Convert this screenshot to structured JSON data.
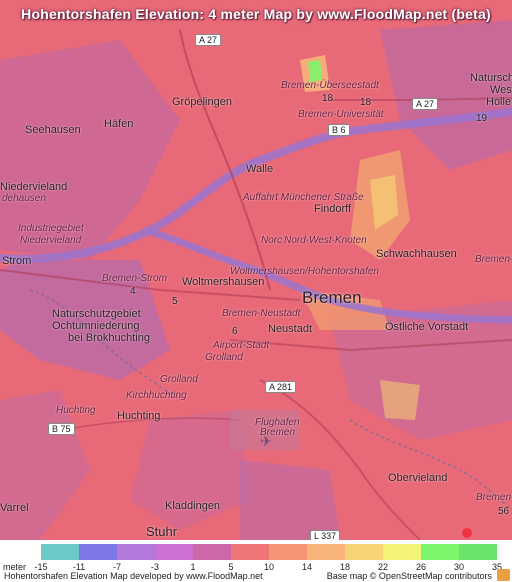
{
  "title": "Hohentorshafen Elevation: 4 meter Map by www.FloodMap.net (beta)",
  "labels": {
    "seehausen": "Seehausen",
    "haefen": "Häfen",
    "groepelingen": "Gröpelingen",
    "walle": "Walle",
    "niedervieland": "Niedervieland",
    "niedervieland_small": "Niedervieland",
    "industriegebiet": "Industriegebiet",
    "strom": "Strom",
    "bremen_strom": "Bremen-Strom",
    "woltmershausen": "Woltmershausen",
    "woltm_hohentor": "Woltmershausen/Hohentorshafen",
    "bremen": "Bremen",
    "neustadt": "Neustadt",
    "bremen_neustadt": "Bremen-Neustadt",
    "airport_stadt": "Airport-Stadt",
    "grolland": "Grolland",
    "grolland2": "Grolland",
    "natur1": "Naturschutzgebiet",
    "natur2": "Ochtumniederung",
    "natur3": "bei Brokhuchting",
    "findorff": "Findorff",
    "auffahrt": "Auffahrt Münchener Straße",
    "knoten": "Nord-West-Knoten",
    "norc": "Norc",
    "schwachhausen": "Schwachhausen",
    "oestliche": "Östliche Vorstadt",
    "kirchhuchting": "Kirchhuchting",
    "huchting_small": "Huchting",
    "huchting": "Huchting",
    "flughafen1": "Flughafen",
    "flughafen2": "Bremen",
    "kladdingen": "Kladdingen",
    "obervieland": "Obervieland",
    "stuhr": "Stuhr",
    "varrel": "Varrel",
    "ueberseestadt": "Bremen-Überseestadt",
    "universitaet": "Bremen-Universität",
    "natursch_r1": "Naturschu",
    "natursch_r2": "Wes",
    "natursch_r3": "Holle",
    "bremen_r": "Bremen-I",
    "bremen_r2": "Bremen-A",
    "dehausen": "dehausen",
    "num_4": "4",
    "num_5": "5",
    "num_6": "6",
    "num_18a": "18",
    "num_18b": "18",
    "num_19": "19",
    "num_56": "56"
  },
  "shields": {
    "a27_top": "A 27",
    "a27_right": "A 27",
    "b6": "B 6",
    "b75": "B 75",
    "a281": "A 281",
    "l337": "L 337"
  },
  "legend": {
    "prefix": "meter",
    "colors": [
      "#6cc9c6",
      "#7c78e8",
      "#b478dc",
      "#cc70d4",
      "#cc68a8",
      "#ee7676",
      "#f49676",
      "#f8b47a",
      "#f6d476",
      "#f4f478",
      "#7cf46c",
      "#6ce46c"
    ],
    "ticks": [
      "-15",
      "-11",
      "-7",
      "-3",
      "1",
      "5",
      "10",
      "14",
      "18",
      "22",
      "26",
      "30",
      "35"
    ]
  },
  "footer": {
    "left": "Hohentorshafen Elevation Map developed by www.FloodMap.net",
    "right": "Base map © OpenStreetMap contributors"
  }
}
